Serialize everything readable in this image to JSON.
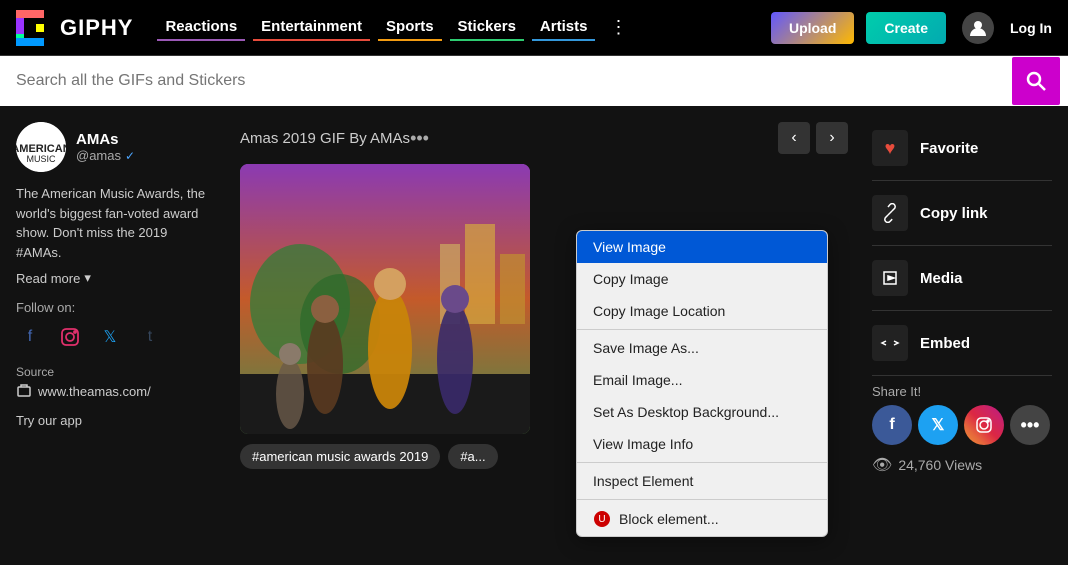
{
  "header": {
    "logo_text": "GIPHY",
    "nav": [
      {
        "id": "reactions",
        "label": "Reactions"
      },
      {
        "id": "entertainment",
        "label": "Entertainment"
      },
      {
        "id": "sports",
        "label": "Sports"
      },
      {
        "id": "stickers",
        "label": "Stickers"
      },
      {
        "id": "artists",
        "label": "Artists"
      }
    ],
    "upload_label": "Upload",
    "create_label": "Create",
    "login_label": "Log In"
  },
  "search": {
    "placeholder": "Search all the GIFs and Stickers"
  },
  "sidebar": {
    "profile_name": "AMAs",
    "profile_handle": "@amas",
    "bio": "The American Music Awards, the world's biggest fan-voted award show. Don't miss the 2019 #AMAs.",
    "read_more": "Read more",
    "follow_label": "Follow on:",
    "source_label": "Source",
    "source_url": "www.theamas.com/",
    "try_app": "Try our app"
  },
  "gif": {
    "title": "Amas 2019 GIF By AMAs",
    "tags": [
      "#american music awards 2019",
      "#a..."
    ]
  },
  "actions": {
    "favorite": "Favorite",
    "copy_link": "Copy link",
    "media": "Media",
    "embed": "Embed",
    "share_label": "Share It!",
    "views": "24,760 Views"
  },
  "context_menu": {
    "items": [
      {
        "label": "View Image",
        "highlighted": true
      },
      {
        "label": "Copy Image",
        "highlighted": false
      },
      {
        "label": "Copy Image Location",
        "highlighted": false
      },
      {
        "label": "Save Image As...",
        "highlighted": false
      },
      {
        "label": "Email Image...",
        "highlighted": false
      },
      {
        "label": "Set As Desktop Background...",
        "highlighted": false
      },
      {
        "label": "View Image Info",
        "highlighted": false
      },
      {
        "label": "Inspect Element",
        "highlighted": false
      },
      {
        "label": "Block element...",
        "highlighted": false,
        "plugin": true
      }
    ]
  }
}
